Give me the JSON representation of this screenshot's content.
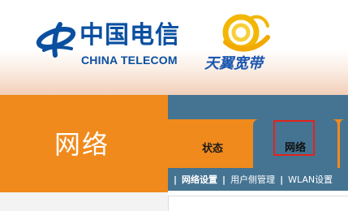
{
  "brand": {
    "carrier_cn": "中国电信",
    "carrier_en": "CHINA TELECOM",
    "product_cn": "天翼宽带",
    "carrier_logo_icon": "china-telecom-logo-icon",
    "product_logo_icon": "tianyi-swirl-logo-icon",
    "colors": {
      "brand_blue": "#0a4fa0",
      "product_yellow": "#f2b705",
      "orange": "#f08a1c",
      "nav_blue": "#457493",
      "highlight_red": "#e2231a"
    }
  },
  "side": {
    "section_title": "网络"
  },
  "nav": {
    "tabs": [
      {
        "label": "状态",
        "active": false
      },
      {
        "label": "网络",
        "active": true
      }
    ]
  },
  "subnav": {
    "items": [
      {
        "label": "网络设置",
        "active": true
      },
      {
        "label": "用户侧管理",
        "active": false
      },
      {
        "label": "WLAN设置",
        "active": false
      }
    ]
  }
}
